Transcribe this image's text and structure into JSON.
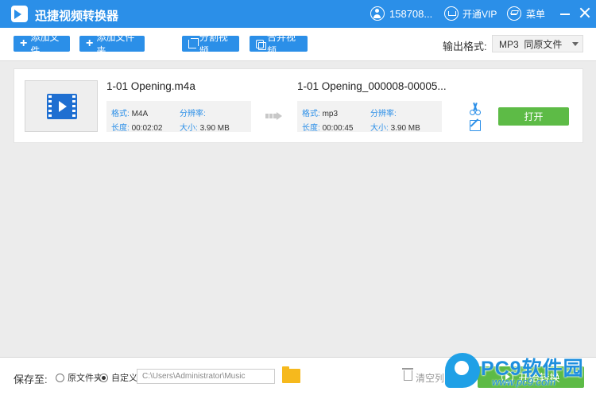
{
  "app": {
    "title": "迅捷视频转换器"
  },
  "titlebar": {
    "user_id": "158708...",
    "vip_label": "开通VIP",
    "menu_label": "菜单"
  },
  "toolbar": {
    "add_file": "添加文件",
    "add_folder": "添加文件夹",
    "split_video": "分割视频",
    "merge_video": "合并视频",
    "format_label": "输出格式:",
    "format_value": "MP3  同原文件"
  },
  "file": {
    "source": {
      "name": "1-01 Opening.m4a",
      "format_label": "格式:",
      "format": "M4A",
      "resolution_label": "分辨率:",
      "resolution": "",
      "duration_label": "长度:",
      "duration": "00:02:02",
      "size_label": "大小:",
      "size": "3.90 MB"
    },
    "output": {
      "name": "1-01 Opening_000008-00005...",
      "format_label": "格式:",
      "format": "mp3",
      "resolution_label": "分辨率:",
      "resolution": "",
      "duration_label": "长度:",
      "duration": "00:00:45",
      "size_label": "大小:",
      "size": "3.90 MB"
    },
    "open_label": "打开"
  },
  "bottom": {
    "save_label": "保存至:",
    "option_original": "原文件夹",
    "option_custom": "自定义",
    "selected_option": "custom",
    "path_value": "C:\\Users\\Administrator\\Music",
    "clear_label": "清空列",
    "start_label": "开始转换"
  },
  "watermark": {
    "brand": "PC9软件园",
    "url": "www.pc9.com"
  },
  "colors": {
    "primary": "#2b8fe8",
    "green": "#5dbb46",
    "folder": "#f6b91d"
  }
}
